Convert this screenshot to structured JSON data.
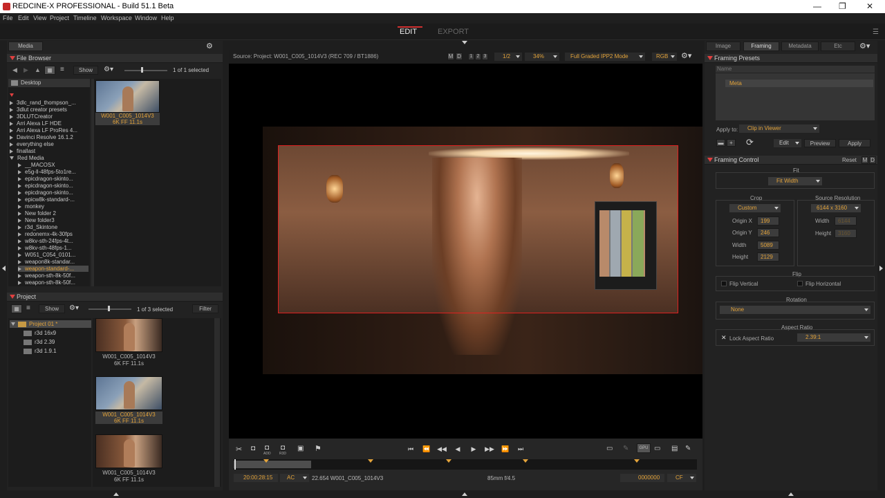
{
  "window": {
    "title": "REDCINE-X PROFESSIONAL - Build 51.1 Beta",
    "minimize": "—",
    "maximize": "❐",
    "close": "✕"
  },
  "menu": [
    "File",
    "Edit",
    "View",
    "Project",
    "Timeline",
    "Workspace",
    "Window",
    "Help"
  ],
  "modes": {
    "edit": "EDIT",
    "export": "EXPORT"
  },
  "left": {
    "media_tab": "Media",
    "file_browser": {
      "title": "File Browser",
      "show": "Show",
      "selected": "1 of 1 selected",
      "location": "Desktop",
      "folders": [
        "3dlc_rand_thompson_...",
        "3dlut creator presets",
        "3DLUTCreator",
        "Arri Alexa LF HDE",
        "Arri Alexa LF ProRes 4...",
        "Davinci Resolve 16.1.2",
        "everything else",
        "finallast",
        "Red Media"
      ],
      "subfolders": [
        "__MACOSX",
        "e5g-ll-48fps-5to1re...",
        "epicdragon-skinto...",
        "epicdragon-skinto...",
        "epicdragon-skinto...",
        "epicw8k-standard-...",
        "monkey",
        "New folder 2",
        "New folder3",
        "r3d_Skintone",
        "redonemx-4k-30fps",
        "w8kv-sth-24fps-4t...",
        "w8kv-sth-48fps-1...",
        "W051_C054_0101...",
        "weapon8k-standar...",
        "weapon-standard-...",
        "weapon-sth-8k-50f...",
        "weapon-sth-8k-50f..."
      ],
      "clip": {
        "name": "W001_C005_1014V3",
        "info": "6K FF   11.1s"
      }
    },
    "project": {
      "title": "Project",
      "show": "Show",
      "selected": "1 of 3 selected",
      "filter": "Filter",
      "root": "Project 01 *",
      "bins": [
        "r3d 16x9",
        "r3d 2.39",
        "r3d 1.9.1"
      ],
      "clips": [
        {
          "name": "W001_C005_1014V3",
          "info": "6K FF   11.1s"
        },
        {
          "name": "W001_C005_1014V3",
          "info": "6K FF   11.1s"
        },
        {
          "name": "W001_C005_1014V3",
          "info": "6K FF   11.1s"
        }
      ]
    }
  },
  "viewer": {
    "source": "Source: Project: W001_C005_1014V3   (REC 709 / BT1886)",
    "m": "M",
    "d": "D",
    "views": [
      "1",
      "2",
      "3"
    ],
    "res": "1/2",
    "zoom": "34%",
    "mode": "Full Graded IPP2 Mode",
    "channel": "RGB"
  },
  "transport": {
    "left_tools": [
      "ADD",
      "R3D"
    ],
    "timecode": "20:00:28:15",
    "tc_mode": "AC",
    "clip_info": "22.654 W001_C005_1014V3",
    "lens": "85mm  f/4.5",
    "frame": "0000000",
    "cf": "CF",
    "gpu": "GPU"
  },
  "right": {
    "tabs": [
      "Image",
      "Framing",
      "Metadata",
      "Etc"
    ],
    "presets": {
      "title": "Framing Presets",
      "name_placeholder": "Name",
      "items": [
        "Meta"
      ],
      "apply_to_label": "Apply to:",
      "apply_to_value": "Clip in Viewer",
      "edit": "Edit",
      "preview": "Preview",
      "apply": "Apply"
    },
    "control": {
      "title": "Framing Control",
      "reset": "Reset",
      "m": "M",
      "d": "D",
      "fit_label": "Fit",
      "fit_value": "Fit Width",
      "crop_label": "Crop",
      "crop_mode": "Custom",
      "origin_x_label": "Origin X",
      "origin_x": "199",
      "origin_y_label": "Origin Y",
      "origin_y": "246",
      "width_label": "Width",
      "width": "5089",
      "height_label": "Height",
      "height": "2129",
      "source_res_label": "Source Resolution",
      "source_res": "6144 x 3160",
      "src_width_label": "Width",
      "src_width": "6144",
      "src_height_label": "Height",
      "src_height": "3160",
      "flip_label": "Flip",
      "flip_vertical": "Flip Vertical",
      "flip_horizontal": "Flip Horizontal",
      "rotation_label": "Rotation",
      "rotation_value": "None",
      "aspect_label": "Aspect Ratio",
      "lock_aspect": "Lock Aspect Ratio",
      "aspect_value": "2.39:1"
    }
  },
  "colors": {
    "accent": "#e3a33a",
    "red": "#d03030",
    "panel": "#262626"
  }
}
